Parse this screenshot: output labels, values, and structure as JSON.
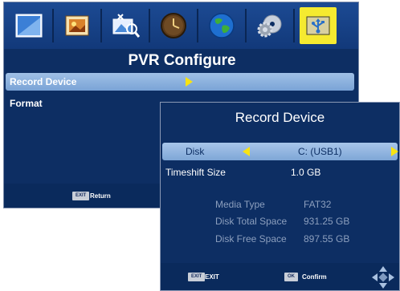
{
  "tabs": [
    {
      "icon": "picture-icon",
      "selected": false
    },
    {
      "icon": "photo-album-icon",
      "selected": false
    },
    {
      "icon": "image-search-icon",
      "selected": false
    },
    {
      "icon": "clock-icon",
      "selected": false
    },
    {
      "icon": "globe-icon",
      "selected": false
    },
    {
      "icon": "settings-disc-icon",
      "selected": false
    },
    {
      "icon": "usb-icon",
      "selected": true
    }
  ],
  "main": {
    "title": "PVR Configure",
    "menu": [
      {
        "label": "Record Device",
        "selected": true
      },
      {
        "label": "Format",
        "selected": false
      }
    ],
    "footer": {
      "key": "EXIT",
      "label": "Return"
    }
  },
  "panel": {
    "title": "Record Device",
    "disk": {
      "label": "Disk",
      "value": "C: (USB1)"
    },
    "timeshift": {
      "label": "Timeshift Size",
      "value": "1.0 GB"
    },
    "info": [
      {
        "label": "Media Type",
        "value": "FAT32"
      },
      {
        "label": "Disk Total Space",
        "value": "931.25 GB"
      },
      {
        "label": "Disk Free Space",
        "value": "897.55 GB"
      }
    ],
    "footer": {
      "exit_key": "EXIT",
      "exit_label": "EXIT",
      "ok_key": "OK",
      "ok_label": "Confirm"
    }
  },
  "colors": {
    "background": "#0d2e63",
    "highlight": "#8fb4e0",
    "arrow": "#f8e312",
    "selected_tab": "#f5ea30"
  }
}
